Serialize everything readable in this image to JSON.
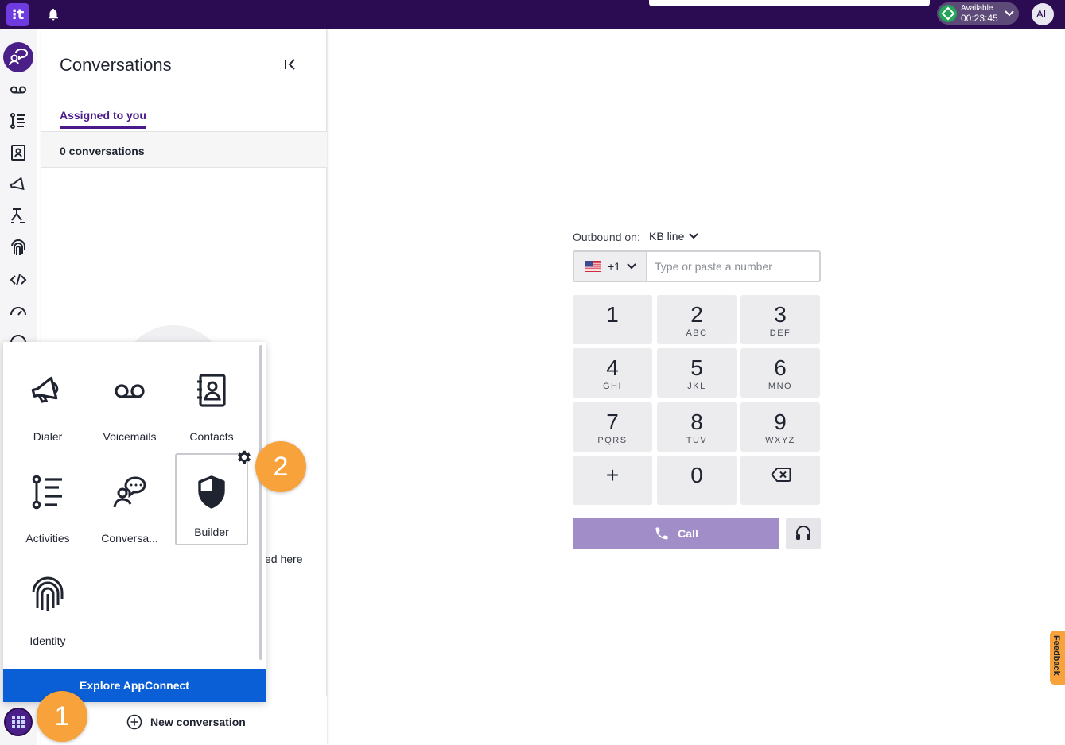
{
  "topbar": {
    "logo_text": "⁝t",
    "status_label": "Available",
    "status_time": "00:23:45",
    "avatar_initials": "AL"
  },
  "conversations": {
    "title": "Conversations",
    "tab_assigned": "Assigned to you",
    "count_text": "0 conversations",
    "empty_text_fragment": "ed here",
    "new_conversation_label": "New conversation"
  },
  "app_connect": {
    "apps": [
      {
        "label": "Dialer",
        "icon": "megaphone-icon"
      },
      {
        "label": "Voicemails",
        "icon": "voicemail-icon"
      },
      {
        "label": "Contacts",
        "icon": "contacts-book-icon"
      },
      {
        "label": "Activities",
        "icon": "activities-list-icon"
      },
      {
        "label": "Conversa...",
        "icon": "conversations-icon"
      },
      {
        "label": "Builder",
        "icon": "shield-icon"
      },
      {
        "label": "Identity",
        "icon": "fingerprint-icon"
      }
    ],
    "explore_label": "Explore AppConnect"
  },
  "markers": {
    "step1": "1",
    "step2": "2"
  },
  "dialer": {
    "outbound_label": "Outbound on:",
    "line_name": "KB line",
    "country_code": "+1",
    "number_placeholder": "Type or paste a number",
    "keys": [
      {
        "digit": "1",
        "letters": ""
      },
      {
        "digit": "2",
        "letters": "ABC"
      },
      {
        "digit": "3",
        "letters": "DEF"
      },
      {
        "digit": "4",
        "letters": "GHI"
      },
      {
        "digit": "5",
        "letters": "JKL"
      },
      {
        "digit": "6",
        "letters": "MNO"
      },
      {
        "digit": "7",
        "letters": "PQRS"
      },
      {
        "digit": "8",
        "letters": "TUV"
      },
      {
        "digit": "9",
        "letters": "WXYZ"
      },
      {
        "digit": "+",
        "letters": ""
      },
      {
        "digit": "0",
        "letters": ""
      }
    ],
    "call_label": "Call"
  },
  "feedback_label": "Feedback",
  "colors": {
    "topbar": "#2b0b52",
    "brand_purple": "#4a2088",
    "status_green": "#23a55a",
    "call_button": "#a18ec8",
    "explore_blue": "#0b5fd6",
    "marker_orange": "#f7a23a"
  }
}
